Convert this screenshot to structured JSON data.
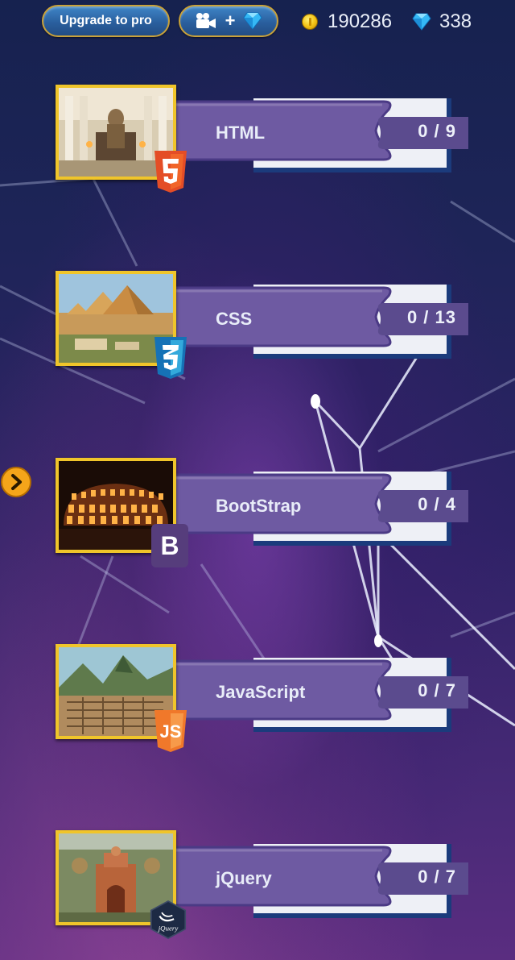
{
  "topbar": {
    "upgrade_label": "Upgrade to pro",
    "video_plus_label": "+",
    "coins": "190286",
    "gems": "338"
  },
  "levels": [
    {
      "name": "HTML",
      "progress": "0 / 9",
      "badge": "html5-icon"
    },
    {
      "name": "CSS",
      "progress": "0 / 13",
      "badge": "css3-icon"
    },
    {
      "name": "BootStrap",
      "progress": "0 / 4",
      "badge": "bootstrap-icon"
    },
    {
      "name": "JavaScript",
      "progress": "0 / 7",
      "badge": "js-icon"
    },
    {
      "name": "jQuery",
      "progress": "0 / 7",
      "badge": "jquery-icon"
    }
  ],
  "badges": {
    "bootstrap_letter": "B",
    "js_letters": "JS",
    "jquery_text": "jQuery"
  },
  "colors": {
    "banner": "#6e5aa2",
    "banner_edge": "#1b3b7c",
    "frame": "#f0c52a",
    "html5": "#e44d26",
    "css3": "#1572b6",
    "bootstrap": "#563d7c",
    "js": "#f0782a",
    "jquery": "#1d2a44"
  }
}
